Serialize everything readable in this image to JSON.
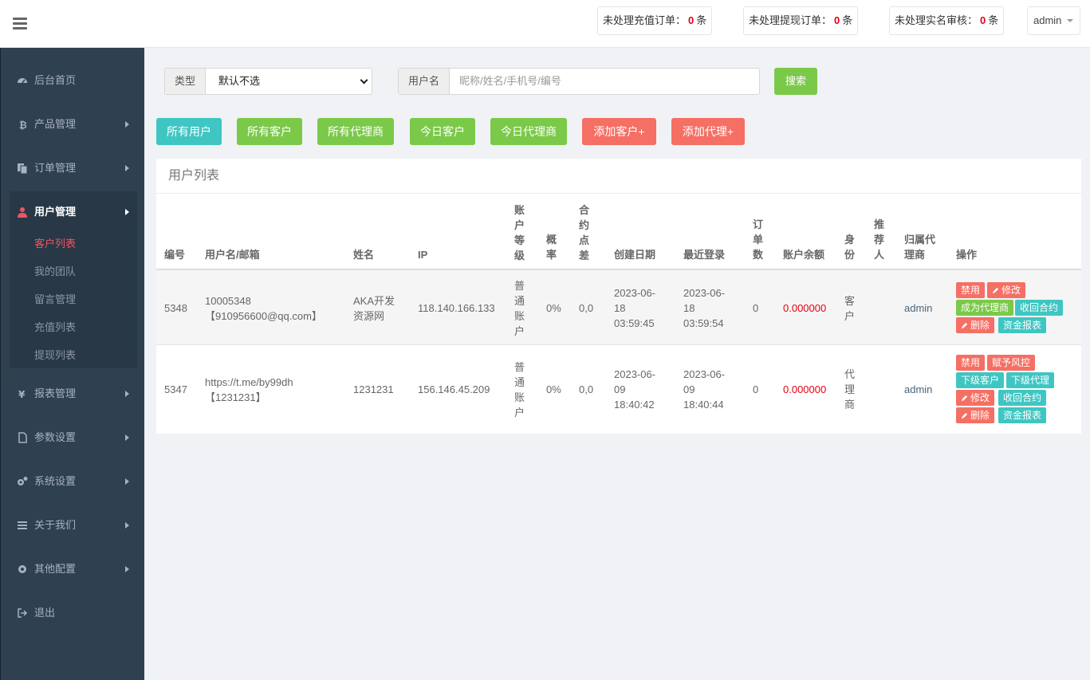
{
  "header": {
    "notices": [
      {
        "label": "未处理充值订单：",
        "count": "0",
        "unit": "条"
      },
      {
        "label": "未处理提现订单：",
        "count": "0",
        "unit": "条"
      },
      {
        "label": "未处理实名审核：",
        "count": "0",
        "unit": "条"
      }
    ],
    "user": "admin"
  },
  "sidebar": {
    "items": [
      {
        "label": "后台首页",
        "icon": "dashboard-icon"
      },
      {
        "label": "产品管理",
        "icon": "bitcoin-icon"
      },
      {
        "label": "订单管理",
        "icon": "copy-icon"
      },
      {
        "label": "用户管理",
        "icon": "user-icon"
      },
      {
        "label": "报表管理",
        "icon": "yen-icon"
      },
      {
        "label": "参数设置",
        "icon": "file-icon"
      },
      {
        "label": "系统设置",
        "icon": "gears-icon"
      },
      {
        "label": "关于我们",
        "icon": "bars-icon"
      },
      {
        "label": "其他配置",
        "icon": "gear-icon"
      },
      {
        "label": "退出",
        "icon": "sign-out-icon"
      }
    ],
    "subitems": [
      "客户列表",
      "我的团队",
      "留言管理",
      "充值列表",
      "提现列表"
    ]
  },
  "search": {
    "type_label": "类型",
    "type_value": "默认不选",
    "user_label": "用户名",
    "user_placeholder": "昵称/姓名/手机号/编号",
    "button": "搜索"
  },
  "filters": [
    "所有用户",
    "所有客户",
    "所有代理商",
    "今日客户",
    "今日代理商",
    "添加客户+",
    "添加代理+"
  ],
  "panel": {
    "title": "用户列表",
    "columns": [
      "编号",
      "用户名/邮箱",
      "姓名",
      "IP",
      "账户等级",
      "概率",
      "合约点差",
      "创建日期",
      "最近登录",
      "订单数",
      "账户余额",
      "身份",
      "推荐人",
      "归属代理商",
      "操作"
    ],
    "rows": [
      {
        "id": "5348",
        "username": "10005348",
        "email": "【910956600@qq.com】",
        "name": "AKA开发资源网",
        "ip": "118.140.166.133",
        "level": "普通账户",
        "rate": "0%",
        "spread": "0,0",
        "created": "2023-06-18 03:59:45",
        "last_login": "2023-06-18 03:59:54",
        "orders": "0",
        "balance": "0.000000",
        "role": "客户",
        "referrer": "",
        "agent": "admin",
        "actions": [
          "禁用",
          "修改",
          "成为代理商",
          "收回合约",
          "删除",
          "资金报表"
        ]
      },
      {
        "id": "5347",
        "username": "https://t.me/by99dh",
        "email": "【1231231】",
        "name": "1231231",
        "ip": "156.146.45.209",
        "level": "普通账户",
        "rate": "0%",
        "spread": "0,0",
        "created": "2023-06-09 18:40:42",
        "last_login": "2023-06-09 18:40:44",
        "orders": "0",
        "balance": "0.000000",
        "role": "代理商",
        "referrer": "",
        "agent": "admin",
        "actions": [
          "禁用",
          "赋予风控",
          "下级客户",
          "下级代理",
          "修改",
          "收回合约",
          "删除",
          "资金报表"
        ]
      }
    ]
  },
  "colors": {
    "sidebar": "#2f4050",
    "green": "#7bc949",
    "cyan": "#3fc6c2",
    "red": "#f56f64",
    "money": "#e60012"
  }
}
